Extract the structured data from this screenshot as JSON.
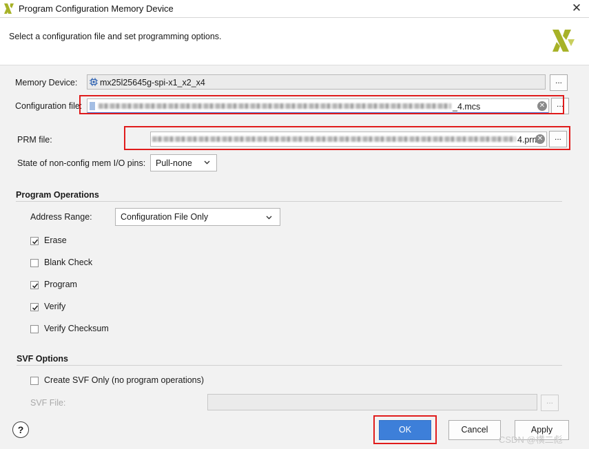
{
  "window": {
    "title": "Program Configuration Memory Device",
    "close_glyph": "✕"
  },
  "header": {
    "instruction": "Select a configuration file and set programming options."
  },
  "memory_device": {
    "label": "Memory Device:",
    "value": "mx25l25645g-spi-x1_x2_x4",
    "browse": "..."
  },
  "config_file": {
    "label": "Configuration file:",
    "value_suffix": "_4.mcs",
    "browse": "..."
  },
  "prm_file": {
    "label": "PRM file:",
    "value_suffix": "4.prm",
    "browse": "..."
  },
  "io_pins": {
    "label": "State of non-config mem I/O pins:",
    "selected": "Pull-none"
  },
  "program_ops": {
    "title": "Program Operations",
    "address_range_label": "Address Range:",
    "address_range_selected": "Configuration File Only",
    "options": [
      {
        "label": "Erase",
        "checked": true
      },
      {
        "label": "Blank Check",
        "checked": false
      },
      {
        "label": "Program",
        "checked": true
      },
      {
        "label": "Verify",
        "checked": true
      },
      {
        "label": "Verify Checksum",
        "checked": false
      }
    ]
  },
  "svf": {
    "title": "SVF Options",
    "create_label": "Create SVF Only (no program operations)",
    "create_checked": false,
    "file_label": "SVF File:",
    "browse": "..."
  },
  "footer": {
    "help": "?",
    "ok": "OK",
    "cancel": "Cancel",
    "apply": "Apply",
    "watermark": "CSDN @横二彪"
  },
  "colors": {
    "accent": "#3d7fd9",
    "highlight_box": "#e01b1b",
    "logo": "#a7b228"
  }
}
